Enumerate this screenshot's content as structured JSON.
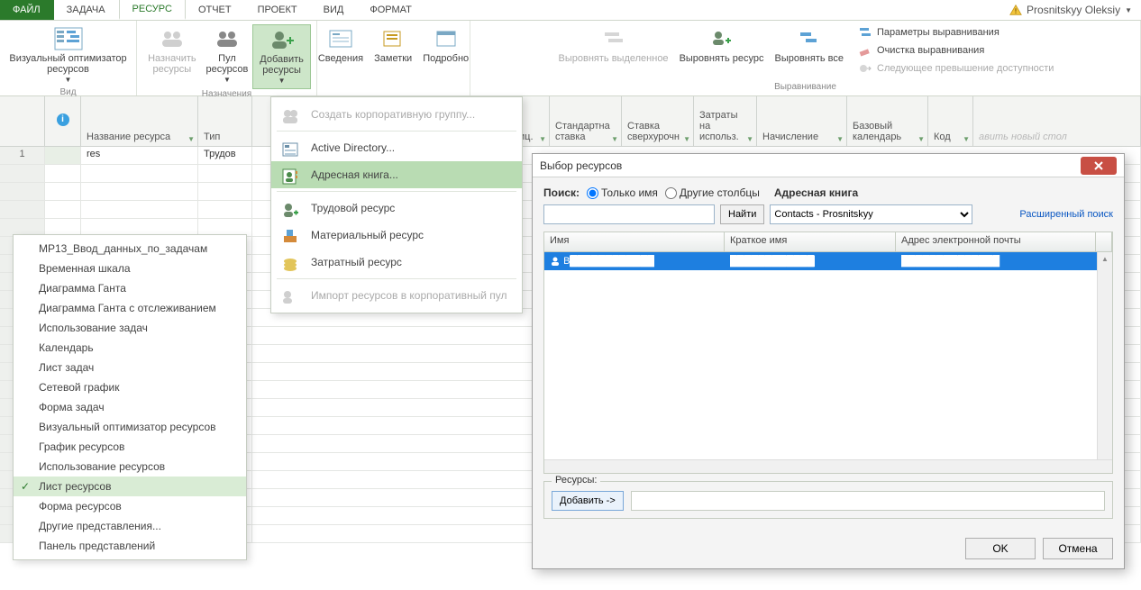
{
  "menu": {
    "tabs": [
      "ФАЙЛ",
      "ЗАДАЧА",
      "РЕСУРС",
      "ОТЧЕТ",
      "ПРОЕКТ",
      "ВИД",
      "ФОРМАТ"
    ],
    "active_index": 2,
    "user": "Prosnitskyy Oleksiy"
  },
  "ribbon": {
    "group_view": {
      "label": "Вид",
      "btn": "Визуальный оптимизатор ресурсов"
    },
    "group_assign": {
      "label": "Назначения",
      "assign": "Назначить ресурсы",
      "pool": "Пул ресурсов",
      "add": "Добавить ресурсы"
    },
    "group_props": {
      "label": "",
      "info": "Сведения",
      "notes": "Заметки",
      "details": "Подробно"
    },
    "group_level": {
      "label": "Выравнивание",
      "lvl_sel": "Выровнять выделенное",
      "lvl_res": "Выровнять ресурс",
      "lvl_all": "Выровнять все",
      "opts": "Параметры выравнивания",
      "clear": "Очистка выравнивания",
      "next": "Следующее превышение доступности"
    }
  },
  "sheet": {
    "headers": {
      "info": "i",
      "name": "Название ресурса",
      "type": "Тип",
      "unit": "иц.",
      "std": "Стандартна ставка",
      "ovt": "Ставка сверхурочн",
      "cost": "Затраты на использ.",
      "accrual": "Начисление",
      "basecal": "Базовый календарь",
      "code": "Код",
      "newcol": "авить новый стол"
    },
    "row1": {
      "num": "1",
      "name": "res",
      "type": "Трудов"
    }
  },
  "view_list": {
    "items": [
      "MP13_Ввод_данных_по_задачам",
      "Временная шкала",
      "Диаграмма Ганта",
      "Диаграмма Ганта с отслеживанием",
      "Использование задач",
      "Календарь",
      "Лист задач",
      "Сетевой график",
      "Форма задач",
      "Визуальный оптимизатор ресурсов",
      "График ресурсов",
      "Использование ресурсов",
      "Лист ресурсов",
      "Форма ресурсов",
      "Другие представления...",
      "Панель представлений"
    ],
    "active_index": 12
  },
  "dd_menu": {
    "items": [
      {
        "label": "Создать корпоративную группу...",
        "disabled": true
      },
      {
        "label": "Active Directory..."
      },
      {
        "label": "Адресная книга...",
        "hover": true
      },
      {
        "label": "Трудовой ресурс"
      },
      {
        "label": "Материальный ресурс"
      },
      {
        "label": "Затратный ресурс"
      },
      {
        "label": "Импорт ресурсов в корпоративный пул",
        "disabled": true
      }
    ]
  },
  "dialog": {
    "title": "Выбор ресурсов",
    "search_label": "Поиск:",
    "radio_name": "Только имя",
    "radio_cols": "Другие столбцы",
    "ab_label": "Адресная книга",
    "find_btn": "Найти",
    "ab_value": "Contacts - Prosnitskyy",
    "adv_link": "Расширенный поиск",
    "col_name": "Имя",
    "col_short": "Краткое имя",
    "col_email": "Адрес электронной почты",
    "row": {
      "name": "В",
      "short": "",
      "email": ""
    },
    "res_legend": "Ресурсы:",
    "add_btn": "Добавить ->",
    "ok": "OK",
    "cancel": "Отмена"
  }
}
